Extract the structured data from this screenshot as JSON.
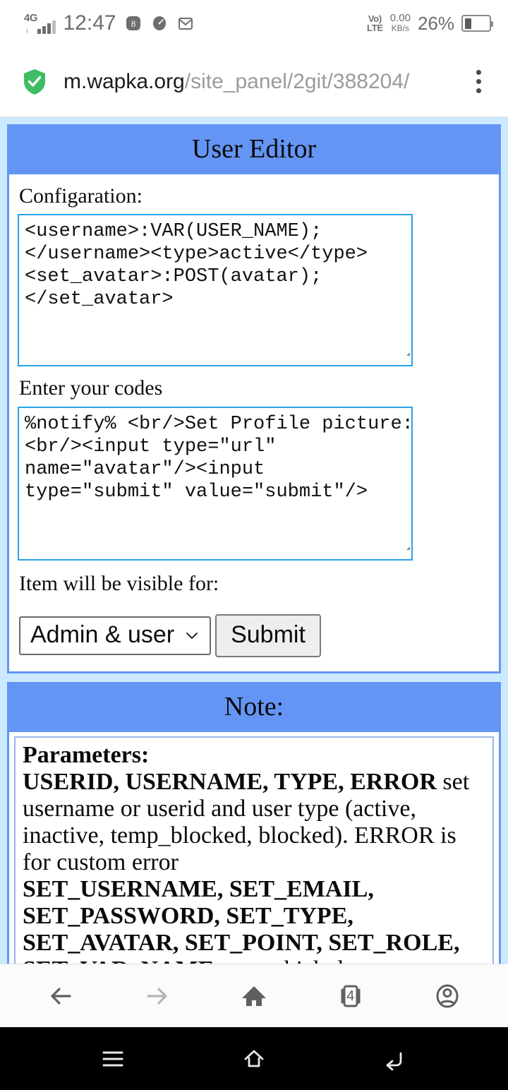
{
  "status_bar": {
    "network_type": "4G",
    "time": "12:47",
    "icons": [
      "billiards-app-icon",
      "speedometer-icon",
      "mail-icon"
    ],
    "volte_top": "Vo)",
    "volte_bottom": "LTE",
    "data_rate_value": "0.00",
    "data_rate_unit": "KB/s",
    "battery_percent": "26%"
  },
  "url_bar": {
    "security": "secure-shield",
    "host": "m.wapka.org",
    "path": "/site_panel/2git/388204/",
    "menu": "three-dot-menu"
  },
  "page": {
    "background_color": "#cceaff",
    "accent_color": "#6495f5",
    "editor_panel": {
      "title": "User Editor",
      "config_label": "Configaration:",
      "config_value": "<username>:VAR(USER_NAME);\n</username><type>active</type>\n<set_avatar>:POST(avatar);\n</set_avatar>",
      "codes_label": "Enter your codes",
      "codes_value": "%notify% <br/>Set Profile picture:\n<br/><input type=\"url\"\nname=\"avatar\"/><input\ntype=\"submit\" value=\"submit\"/>",
      "visibility_label": "Item will be visible for:",
      "visibility_selected": "Admin & user",
      "visibility_options": [
        "Admin & user"
      ],
      "submit_label": "Submit"
    },
    "note_panel": {
      "title": "Note:",
      "heading": "Parameters:",
      "line1_bold": "USERID, USERNAME, TYPE, ERROR",
      "line1_rest": " set username or userid and user type (active, inactive, temp_blocked, blocked). ERROR is for custom error",
      "line2_bold": "SET_USERNAME, SET_EMAIL, SET_PASSWORD, SET_TYPE, SET_AVATAR, SET_POINT, SET_ROLE, SET_VAR_NAME",
      "line2_rest": " - set which data you want to edit. To Change username use"
    }
  },
  "browser_nav": {
    "back": "back-arrow",
    "forward": "forward-arrow",
    "home": "home",
    "tabs_count": "4",
    "account": "account"
  },
  "android_nav": {
    "recents": "recents-menu",
    "home": "home",
    "back": "back"
  }
}
